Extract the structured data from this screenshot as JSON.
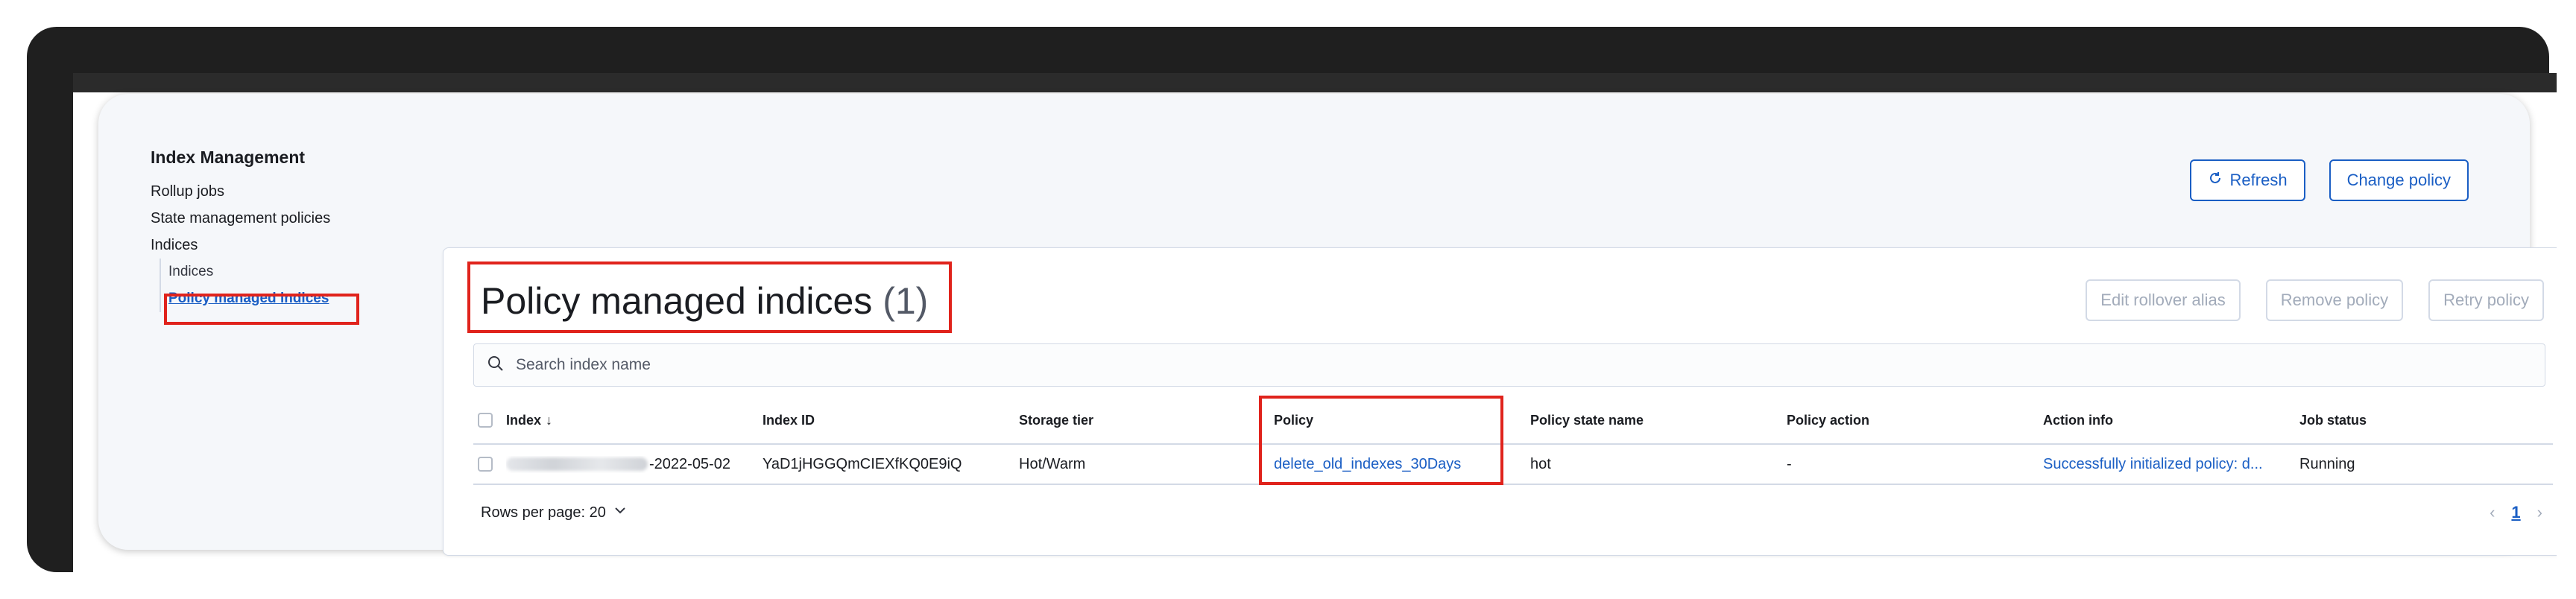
{
  "sidebar": {
    "title": "Index Management",
    "items": [
      {
        "label": "Rollup jobs"
      },
      {
        "label": "State management policies"
      },
      {
        "label": "Indices"
      }
    ],
    "sub_items": [
      {
        "label": "Indices"
      },
      {
        "label": "Policy managed indices"
      }
    ]
  },
  "header": {
    "refresh_label": "Refresh",
    "change_policy_label": "Change policy"
  },
  "main": {
    "title": "Policy managed indices",
    "count": "(1)",
    "actions": {
      "edit_rollover": "Edit rollover alias",
      "remove_policy": "Remove policy",
      "retry_policy": "Retry policy"
    },
    "search": {
      "placeholder": "Search index name",
      "value": ""
    },
    "columns": [
      "Index",
      "Index ID",
      "Storage tier",
      "Policy",
      "Policy state name",
      "Policy action",
      "Action info",
      "Job status"
    ],
    "rows": [
      {
        "index_suffix": "-2022-05-02",
        "index_id": "YaD1jHGGQmCIEXfKQ0E9iQ",
        "storage_tier": "Hot/Warm",
        "policy": "delete_old_indexes_30Days",
        "policy_state": "hot",
        "policy_action": "-",
        "action_info": "Successfully initialized policy: d...",
        "job_status": "Running"
      }
    ],
    "footer": {
      "rows_per_page": "Rows per page: 20",
      "current_page": "1"
    }
  },
  "colors": {
    "accent": "#1a5ec4",
    "highlight_box": "#e0231c",
    "frame": "#1f1f1f"
  }
}
